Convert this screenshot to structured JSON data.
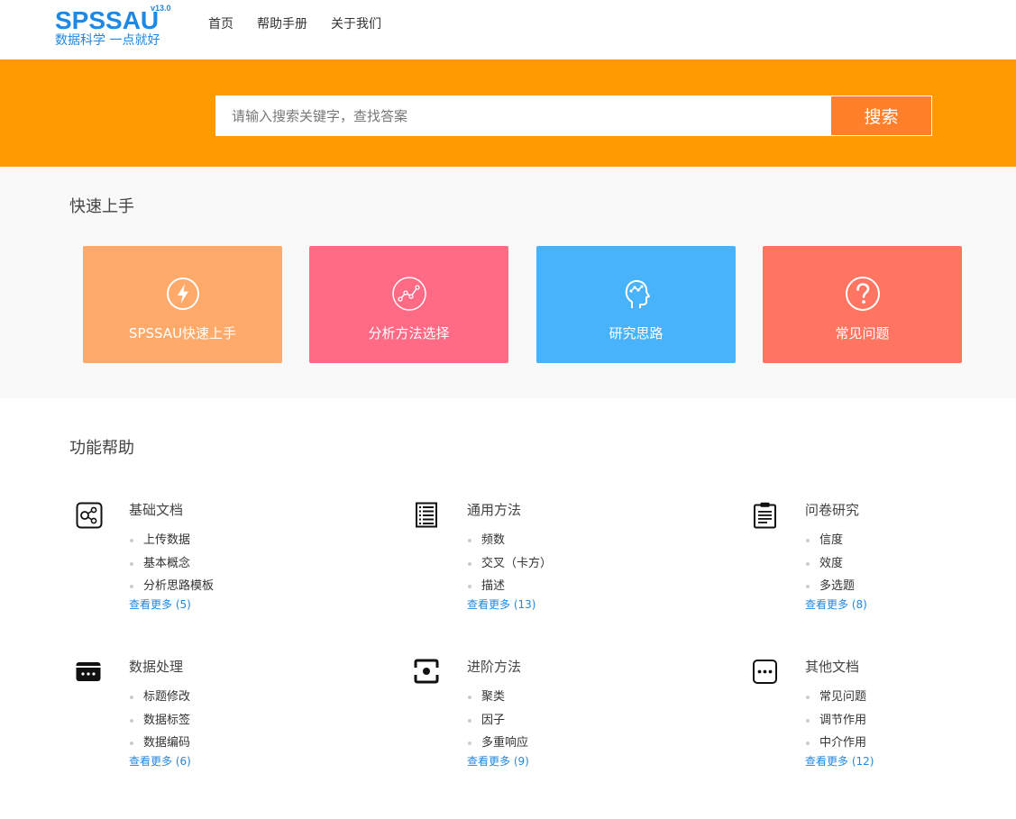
{
  "header": {
    "logo_text": "SPSSAU",
    "logo_version": "v13.0",
    "logo_slogan": "数据科学  一点就好",
    "nav": [
      "首页",
      "帮助手册",
      "关于我们"
    ]
  },
  "search": {
    "placeholder": "请输入搜索关键字，查找答案",
    "button_label": "搜索"
  },
  "quick_start": {
    "title": "快速上手",
    "cards": [
      {
        "label": "SPSSAU快速上手",
        "icon": "lightning-icon",
        "color": "#ffaa6b"
      },
      {
        "label": "分析方法选择",
        "icon": "line-chart-icon",
        "color": "#ff6a85"
      },
      {
        "label": "研究思路",
        "icon": "head-brain-icon",
        "color": "#48b3fb"
      },
      {
        "label": "常见问题",
        "icon": "question-icon",
        "color": "#ff7562"
      }
    ]
  },
  "function_help": {
    "title": "功能帮助",
    "groups": [
      {
        "title": "基础文档",
        "icon": "nodes-icon",
        "items": [
          "上传数据",
          "基本概念",
          "分析思路模板"
        ],
        "more": "查看更多 (5)"
      },
      {
        "title": "通用方法",
        "icon": "list-doc-icon",
        "items": [
          "频数",
          "交叉（卡方）",
          "描述"
        ],
        "more": "查看更多 (13)"
      },
      {
        "title": "问卷研究",
        "icon": "clipboard-icon",
        "items": [
          "信度",
          "效度",
          "多选题"
        ],
        "more": "查看更多 (8)"
      },
      {
        "title": "数据处理",
        "icon": "card-icon",
        "items": [
          "标题修改",
          "数据标签",
          "数据编码"
        ],
        "more": "查看更多 (6)"
      },
      {
        "title": "进阶方法",
        "icon": "target-frame-icon",
        "items": [
          "聚类",
          "因子",
          "多重响应"
        ],
        "more": "查看更多 (9)"
      },
      {
        "title": "其他文档",
        "icon": "more-dots-icon",
        "items": [
          "常见问题",
          "调节作用",
          "中介作用"
        ],
        "more": "查看更多 (12)"
      }
    ]
  }
}
